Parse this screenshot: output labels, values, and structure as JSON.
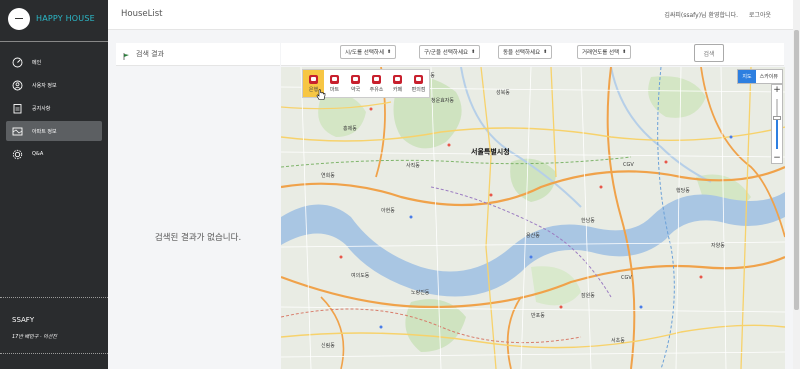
{
  "sidebar": {
    "brand": "HAPPY HOUSE",
    "items": [
      {
        "label": "메인",
        "icon": "dashboard-icon",
        "active": false
      },
      {
        "label": "사용자 정보",
        "icon": "user-icon",
        "active": false
      },
      {
        "label": "공지사항",
        "icon": "clipboard-icon",
        "active": false
      },
      {
        "label": "아파트 정보",
        "icon": "map-icon",
        "active": true
      },
      {
        "label": "Q&A",
        "icon": "gear-icon",
        "active": false
      }
    ],
    "user": "SSAFY",
    "sub": "17반 배민구 · 이선진"
  },
  "header": {
    "title": "HouseList",
    "welcome": "김싸피(ssafy)님 환영합니다.",
    "logout": "로그아웃"
  },
  "results": {
    "title": "검색 결과",
    "empty": "검색된 결과가 없습니다."
  },
  "filters": {
    "sido": "시/도를 선택하세",
    "gugun": "구/군을 선택하세요",
    "dong": "동을 선택하세요",
    "year": "거래연도를 선택",
    "search": "검색"
  },
  "map": {
    "categories": [
      "은행",
      "마트",
      "약국",
      "주유소",
      "카페",
      "편의점"
    ],
    "type_map": "지도",
    "type_sky": "스카이뷰",
    "zoom_in": "+",
    "zoom_out": "−",
    "labels": {
      "city_hall": "서울특별시청",
      "l1": "청운효자동",
      "l2": "사직동",
      "l3": "평창동",
      "l4": "성북동",
      "l5": "홍제동",
      "l6": "연희동",
      "l7": "아현동",
      "l8": "용산동",
      "l9": "여의도동",
      "l10": "노량진동",
      "l11": "반포동",
      "l12": "잠원동",
      "l13": "신림동",
      "l14": "CGV",
      "l15": "CGV",
      "l16": "서초동",
      "l17": "한남동",
      "l18": "행당동",
      "l19": "자양동"
    }
  }
}
